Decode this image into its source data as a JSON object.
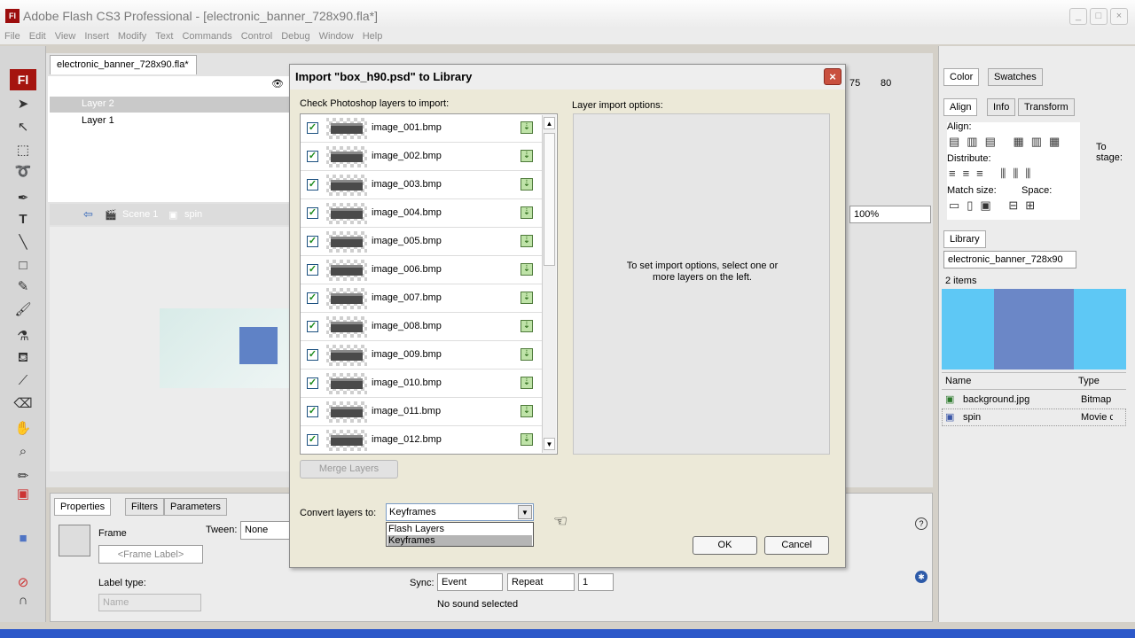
{
  "window": {
    "title": "Adobe Flash CS3 Professional - [electronic_banner_728x90.fla*]",
    "logo": "Fl"
  },
  "menu": [
    "File",
    "Edit",
    "View",
    "Insert",
    "Modify",
    "Text",
    "Commands",
    "Control",
    "Debug",
    "Window",
    "Help"
  ],
  "toolbar_logo": "Fl",
  "document": {
    "tab_label": "electronic_banner_728x90.fla*",
    "layers": [
      "Layer 2",
      "Layer 1"
    ],
    "scene": "Scene 1",
    "symbol": "spin",
    "zoom": "100%",
    "ruler_marks": [
      "75",
      "80"
    ]
  },
  "properties": {
    "tabs": [
      "Properties",
      "Filters",
      "Parameters"
    ],
    "frame_label": "Frame",
    "frame_label_placeholder": "<Frame Label>",
    "tween_label": "Tween:",
    "tween_value": "None",
    "label_type_label": "Label type:",
    "label_type_value": "Name",
    "sync_label": "Sync:",
    "sync_value": "Event",
    "repeat_value": "Repeat",
    "repeat_count": "1",
    "sound_status": "No sound selected"
  },
  "right_panels": {
    "color_tabs": [
      "Color",
      "Swatches"
    ],
    "align_tabs": [
      "Align",
      "Info",
      "Transform"
    ],
    "align_label": "Align:",
    "distribute_label": "Distribute:",
    "match_size_label": "Match size:",
    "space_label": "Space:",
    "to_stage_label": "To stage:",
    "library_tab": "Library",
    "library_file": "electronic_banner_728x90",
    "item_count": "2 items",
    "columns": [
      "Name",
      "Type"
    ],
    "items": [
      {
        "name": "background.jpg",
        "type": "Bitmap"
      },
      {
        "name": "spin",
        "type": "Movie c"
      }
    ]
  },
  "dialog": {
    "title": "Import \"box_h90.psd\" to Library",
    "check_label": "Check Photoshop layers to import:",
    "options_label": "Layer import options:",
    "options_hint": "To set import options, select one or more layers on the left.",
    "layers": [
      "image_001.bmp",
      "image_002.bmp",
      "image_003.bmp",
      "image_004.bmp",
      "image_005.bmp",
      "image_006.bmp",
      "image_007.bmp",
      "image_008.bmp",
      "image_009.bmp",
      "image_010.bmp",
      "image_011.bmp",
      "image_012.bmp"
    ],
    "merge_button": "Merge Layers",
    "convert_label": "Convert layers to:",
    "convert_value": "Keyframes",
    "convert_options": [
      "Flash Layers",
      "Keyframes"
    ],
    "ok": "OK",
    "cancel": "Cancel"
  }
}
